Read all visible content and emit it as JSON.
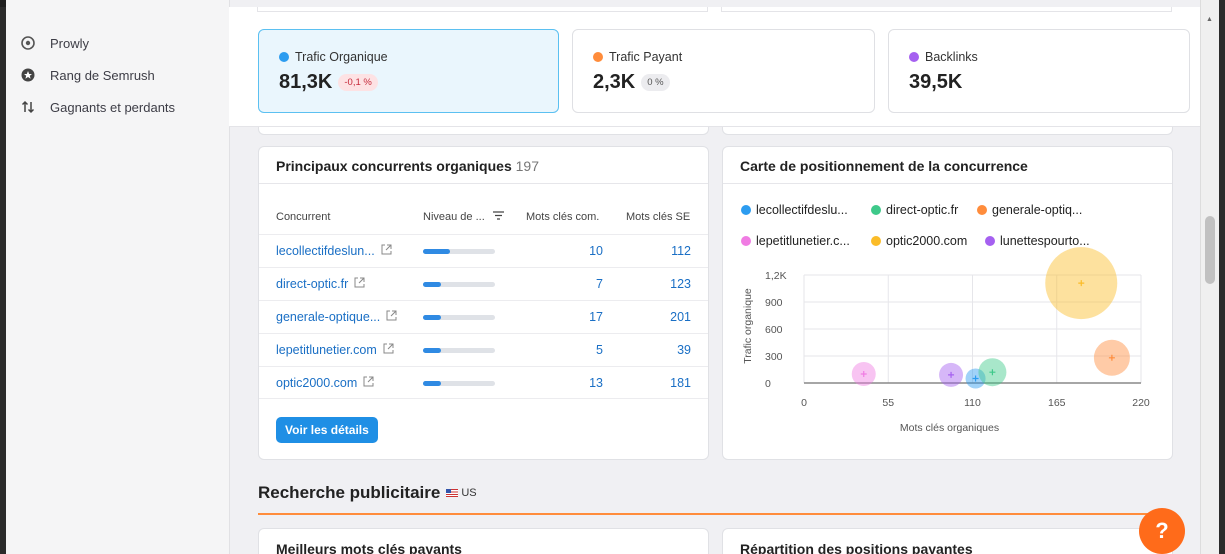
{
  "sidebar": {
    "items": [
      {
        "label": "Prowly",
        "icon": "prowly-icon"
      },
      {
        "label": "Rang de Semrush",
        "icon": "semrush-rank-icon"
      },
      {
        "label": "Gagnants et perdants",
        "icon": "winners-losers-icon"
      }
    ]
  },
  "kpis": [
    {
      "label": "Trafic Organique",
      "value": "81,3K",
      "delta": "-0,1 %",
      "color": "#2c9cf0"
    },
    {
      "label": "Trafic Payant",
      "value": "2,3K",
      "delta": "0 %",
      "color": "#ff8c3b"
    },
    {
      "label": "Backlinks",
      "value": "39,5K",
      "color": "#a560f0"
    }
  ],
  "competitors": {
    "title": "Principaux concurrents organiques",
    "count": "197",
    "headers": {
      "competitor": "Concurrent",
      "level": "Niveau de ...",
      "common": "Mots clés com.",
      "se": "Mots clés SE"
    },
    "rows": [
      {
        "name": "lecollectifdeslun...",
        "level": 0.38,
        "common": "10",
        "se": "112"
      },
      {
        "name": "direct-optic.fr",
        "level": 0.25,
        "common": "7",
        "se": "123"
      },
      {
        "name": "generale-optique...",
        "level": 0.25,
        "common": "17",
        "se": "201"
      },
      {
        "name": "lepetitlunetier.com",
        "level": 0.25,
        "common": "5",
        "se": "39"
      },
      {
        "name": "optic2000.com",
        "level": 0.25,
        "common": "13",
        "se": "181"
      }
    ],
    "button": "Voir les détails"
  },
  "positioning": {
    "title": "Carte de positionnement de la concurrence",
    "legend": [
      {
        "label": "lecollectifdeslu...",
        "color": "#2c9cf0"
      },
      {
        "label": "direct-optic.fr",
        "color": "#3ec98a"
      },
      {
        "label": "generale-optiq...",
        "color": "#ff8c3b"
      },
      {
        "label": "lepetitlunetier.c...",
        "color": "#f07ce3"
      },
      {
        "label": "optic2000.com",
        "color": "#fbbc28"
      },
      {
        "label": "lunettespourto...",
        "color": "#a560f0"
      }
    ]
  },
  "chart_data": {
    "type": "scatter",
    "xlabel": "Mots clés organiques",
    "ylabel": "Trafic organique",
    "xlim": [
      0,
      220
    ],
    "ylim": [
      0,
      1200
    ],
    "x_ticks": [
      "0",
      "55",
      "110",
      "165",
      "220"
    ],
    "y_ticks": [
      "0",
      "300",
      "600",
      "900",
      "1,2K"
    ],
    "series": [
      {
        "name": "lecollectifdeslu...",
        "x": 112,
        "y": 50,
        "size": 10,
        "color": "#2c9cf0"
      },
      {
        "name": "direct-optic.fr",
        "x": 123,
        "y": 120,
        "size": 14,
        "color": "#3ec98a"
      },
      {
        "name": "generale-optiq...",
        "x": 201,
        "y": 280,
        "size": 18,
        "color": "#ff8c3b"
      },
      {
        "name": "lepetitlunetier.c...",
        "x": 39,
        "y": 100,
        "size": 12,
        "color": "#f07ce3"
      },
      {
        "name": "optic2000.com",
        "x": 181,
        "y": 1110,
        "size": 36,
        "color": "#fbbc28"
      },
      {
        "name": "lunettespourto...",
        "x": 96,
        "y": 90,
        "size": 12,
        "color": "#a560f0"
      }
    ]
  },
  "ads": {
    "title": "Recherche publicitaire",
    "country": "US",
    "left_card": "Meilleurs mots clés payants",
    "right_card": "Répartition des positions payantes"
  },
  "help": "?"
}
